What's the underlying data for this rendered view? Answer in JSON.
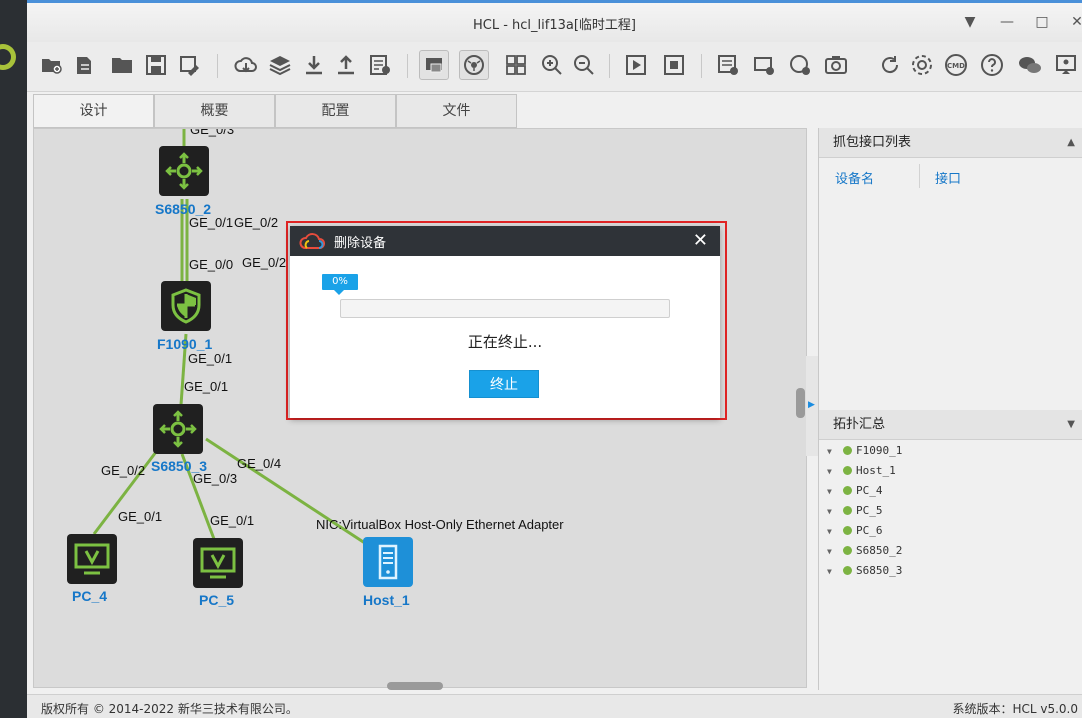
{
  "window": {
    "title": "HCL - hcl_lif13a[临时工程]",
    "buttons": {
      "dropdown": "▼",
      "minimize": "—",
      "maximize": "□",
      "close": "✕"
    }
  },
  "toolbar": {
    "icons": [
      "new-project-icon",
      "open-project-icon",
      "folder-icon",
      "save-icon",
      "save-as-icon",
      "cloud-download-icon",
      "layers-icon",
      "import-icon",
      "export-icon",
      "log-icon",
      "topology-view-icon",
      "network-view-icon",
      "grid-icon",
      "zoom-in-icon",
      "zoom-out-icon",
      "start-icon",
      "stop-icon",
      "add-note-icon",
      "add-rectangle-icon",
      "add-ellipse-icon",
      "screenshot-icon",
      "refresh-icon",
      "settings-icon",
      "cmd-icon",
      "help-icon",
      "wechat-icon",
      "feedback-icon"
    ],
    "cmd_label": "CMD"
  },
  "tabs": [
    {
      "label": "设计"
    },
    {
      "label": "概要"
    },
    {
      "label": "配置"
    },
    {
      "label": "文件"
    }
  ],
  "devices": [
    {
      "name": "S6850_2",
      "type": "switch"
    },
    {
      "name": "F1090_1",
      "type": "firewall"
    },
    {
      "name": "S6850_3",
      "type": "switch"
    },
    {
      "name": "PC_4",
      "type": "pc"
    },
    {
      "name": "PC_5",
      "type": "pc"
    },
    {
      "name": "Host_1",
      "type": "host"
    }
  ],
  "ports": {
    "p1": "GE_0/3",
    "p2": "GE_0/1",
    "p3": "GE_0/2",
    "p4": "GE_0/0",
    "p5": "GE_0/2",
    "p6": "GE_0/1",
    "p7": "GE_0/1",
    "p8": "GE_0/2",
    "p9": "GE_0/4",
    "p10": "GE_0/3",
    "p11": "GE_0/1",
    "p12": "GE_0/1",
    "p13": "NIC:VirtualBox Host-Only Ethernet Adapter"
  },
  "capture_panel": {
    "title": "抓包接口列表",
    "col_device": "设备名",
    "col_interface": "接口"
  },
  "topology_panel": {
    "title": "拓扑汇总",
    "items": [
      "F1090_1",
      "Host_1",
      "PC_4",
      "PC_5",
      "PC_6",
      "S6850_2",
      "S6850_3"
    ]
  },
  "statusbar": {
    "copyright": "版权所有 © 2014-2022 新华三技术有限公司。",
    "version": "系统版本：HCL v5.0.0"
  },
  "dialog": {
    "title": "删除设备",
    "progress_label": "0%",
    "progress_value": 0,
    "message": "正在终止...",
    "button": "终止"
  },
  "colors": {
    "link": "#7cb342",
    "device_label": "#1677c8",
    "accent": "#1aa2e8",
    "highlight_border": "#e02424"
  }
}
